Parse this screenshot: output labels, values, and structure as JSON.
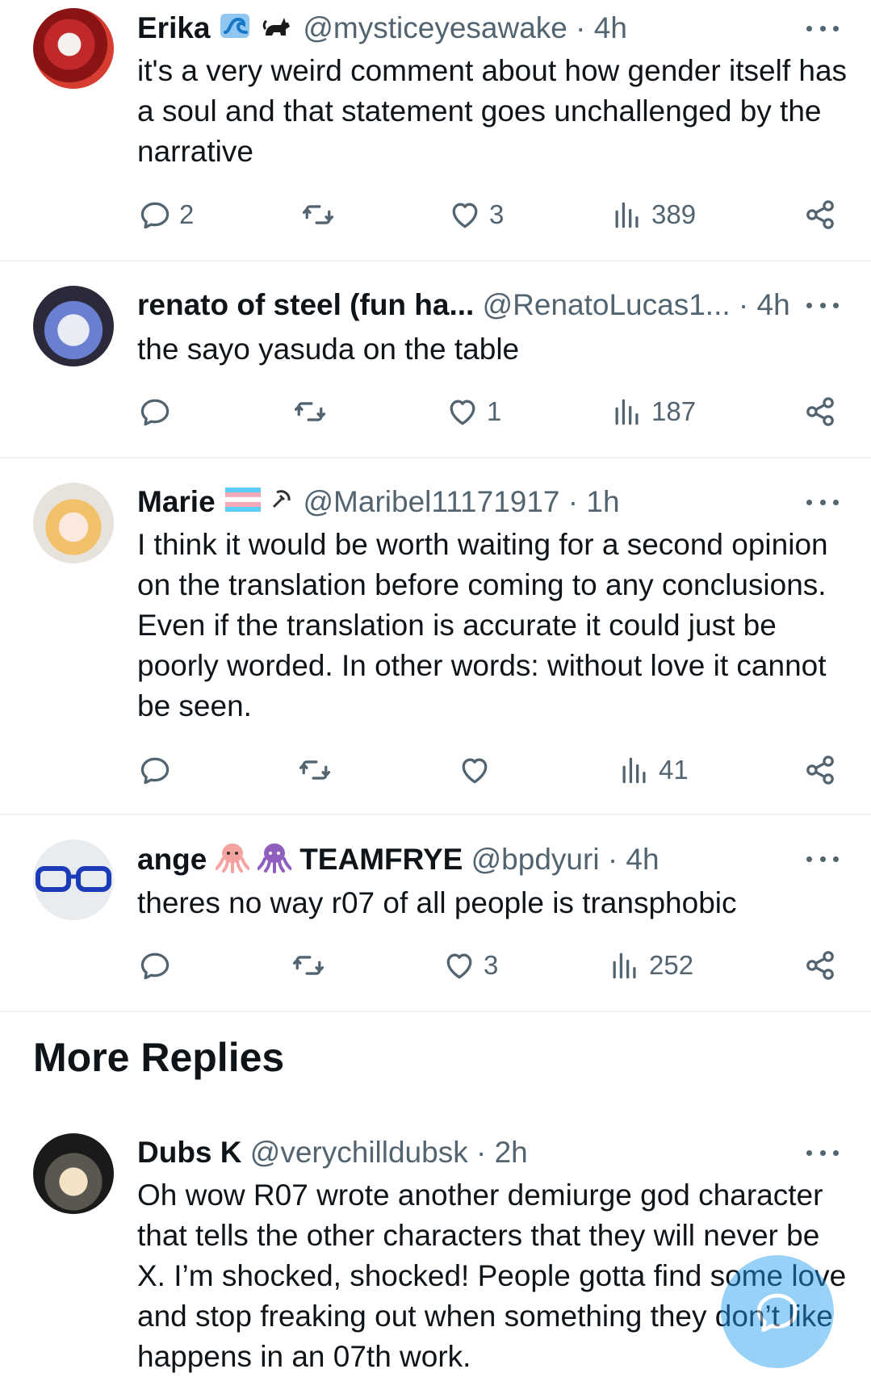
{
  "replies": [
    {
      "name": "Erika",
      "handle": "@mysticeyesawake",
      "time": "· 4h",
      "text": "it's a very weird comment about how gender itself has a soul and that statement goes unchallenged by the narrative",
      "replies": "2",
      "retweets": "",
      "likes": "3",
      "views": "389"
    },
    {
      "name": "renato of steel (fun ha...",
      "handle": "@RenatoLucas1...",
      "time": "· 4h",
      "text": "the sayo yasuda on the table",
      "replies": "",
      "retweets": "",
      "likes": "1",
      "views": "187"
    },
    {
      "name": "Marie",
      "handle": "@Maribel11171917",
      "time": "· 1h",
      "text": "I think it would be worth waiting for a second opinion on the translation before coming to any conclusions. Even if the translation is accurate it could just be poorly worded. In other words: without love it cannot be seen.",
      "replies": "",
      "retweets": "",
      "likes": "",
      "views": "41"
    },
    {
      "name": "ange",
      "name2": "TEAMFRYE",
      "handle": "@bpdyuri",
      "time": "· 4h",
      "text": "theres no way r07 of all people is transphobic",
      "replies": "",
      "retweets": "",
      "likes": "3",
      "views": "252"
    }
  ],
  "more_replies_title": "More Replies",
  "more": {
    "name": "Dubs K",
    "handle": "@verychilldubsk",
    "time": "· 2h",
    "text": "Oh wow R07 wrote another demiurge god character that tells the other characters that they will never be X. I’m shocked, shocked! People gotta find some love and stop freaking out when something they don’t like happens in an 07th work."
  },
  "icons": {
    "reply": "reply-icon",
    "retweet": "retweet-icon",
    "like": "heart-icon",
    "views": "views-icon",
    "share": "share-icon",
    "more": "more-dots-icon",
    "compose": "compose-icon"
  },
  "colors": {
    "text": "#0f1419",
    "secondary": "#536471",
    "accent": "#1d9bf0",
    "divider": "#eff3f4"
  }
}
